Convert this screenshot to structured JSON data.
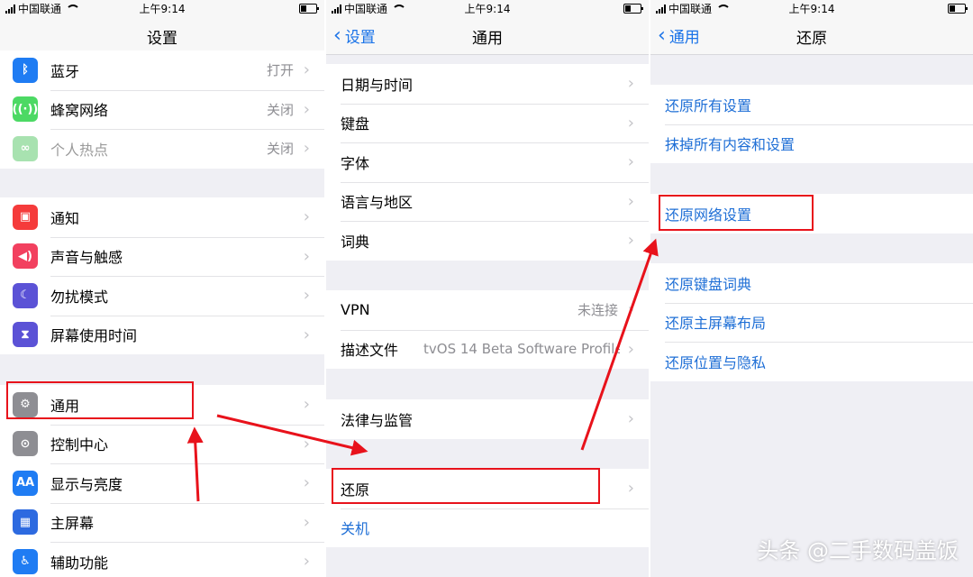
{
  "status": {
    "carrier": "中国联通",
    "time": "上午9:14"
  },
  "panel1": {
    "title": "设置",
    "group1": [
      {
        "label": "蓝牙",
        "value": "打开",
        "icon": "bluetooth-icon",
        "color": "#1f7cf3"
      },
      {
        "label": "蜂窝网络",
        "value": "关闭",
        "icon": "cellular-icon",
        "color": "#4cd964"
      },
      {
        "label": "个人热点",
        "value": "关闭",
        "icon": "hotspot-icon",
        "color": "#a8e2b0"
      }
    ],
    "group2": [
      {
        "label": "通知",
        "icon": "notifications-icon",
        "color": "#f53b3b"
      },
      {
        "label": "声音与触感",
        "icon": "sounds-icon",
        "color": "#f2405f"
      },
      {
        "label": "勿扰模式",
        "icon": "moon-icon",
        "color": "#5b52d6"
      },
      {
        "label": "屏幕使用时间",
        "icon": "hourglass-icon",
        "color": "#5b52d6"
      }
    ],
    "group3": [
      {
        "label": "通用",
        "icon": "gear-icon",
        "color": "#8e8e93"
      },
      {
        "label": "控制中心",
        "icon": "toggles-icon",
        "color": "#8e8e93"
      },
      {
        "label": "显示与亮度",
        "icon": "display-icon",
        "color": "#1f7cf3",
        "glyph": "AA"
      },
      {
        "label": "主屏幕",
        "icon": "grid-icon",
        "color": "#2d6ae0"
      },
      {
        "label": "辅助功能",
        "icon": "accessibility-icon",
        "color": "#1f7cf3"
      }
    ]
  },
  "panel2": {
    "back": "设置",
    "title": "通用",
    "group1": [
      "日期与时间",
      "键盘",
      "字体",
      "语言与地区",
      "词典"
    ],
    "group2": [
      {
        "label": "VPN",
        "value": "未连接"
      },
      {
        "label": "描述文件",
        "value": "tvOS 14 Beta Software Profile"
      }
    ],
    "group3": [
      "法律与监管"
    ],
    "group4": [
      "还原",
      "关机"
    ]
  },
  "panel3": {
    "back": "通用",
    "title": "还原",
    "group1": [
      "还原所有设置",
      "抹掉所有内容和设置"
    ],
    "group2": [
      "还原网络设置"
    ],
    "group3": [
      "还原键盘词典",
      "还原主屏幕布局",
      "还原位置与隐私"
    ]
  },
  "watermark": "头条 @二手数码盖饭",
  "colors": {
    "highlight": "#e8121b",
    "link": "#1f6fd6"
  }
}
